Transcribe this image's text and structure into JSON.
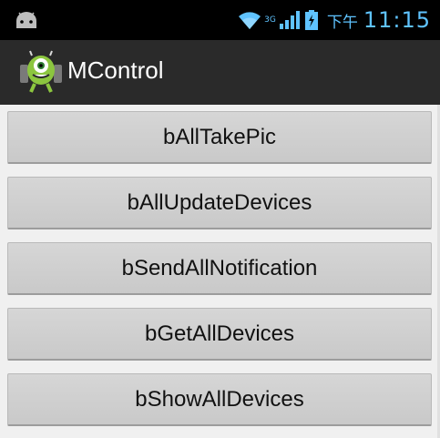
{
  "status_bar": {
    "network_label": "3G",
    "time_prefix": "下午",
    "time": "11:15",
    "icons": [
      "android-notification-icon",
      "wifi-icon",
      "mobile-signal-icon",
      "battery-charging-icon"
    ],
    "accent_color": "#5fc3ff"
  },
  "action_bar": {
    "title": "MControl",
    "icon": "monster-app-icon"
  },
  "buttons": [
    {
      "label": "bAllTakePic"
    },
    {
      "label": "bAllUpdateDevices"
    },
    {
      "label": "bSendAllNotification"
    },
    {
      "label": "bGetAllDevices"
    },
    {
      "label": "bShowAllDevices"
    }
  ]
}
